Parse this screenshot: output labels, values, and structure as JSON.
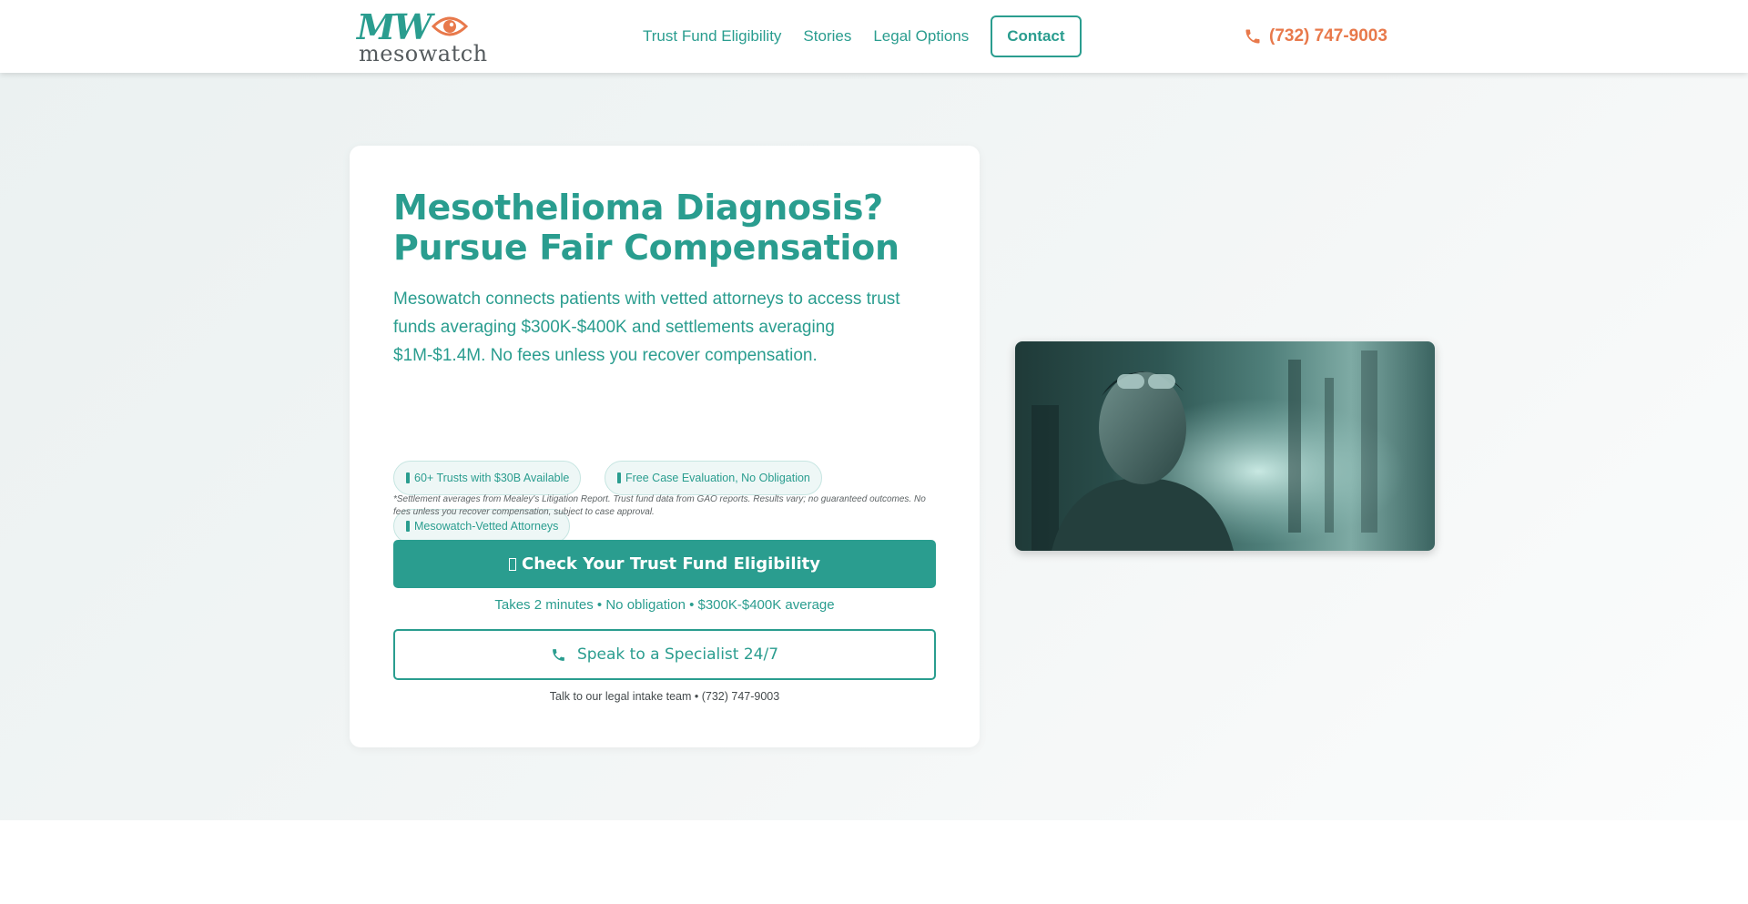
{
  "header": {
    "logo_mark": "MW",
    "logo_word": "mesowatch",
    "nav": [
      {
        "label": "Trust Fund Eligibility"
      },
      {
        "label": "Stories"
      },
      {
        "label": "Legal Options"
      }
    ],
    "contact_label": "Contact",
    "phone": "(732) 747-9003",
    "phone_icon": "phone-icon"
  },
  "hero": {
    "title_line1": "Mesothelioma Diagnosis?",
    "title_line2": "Pursue Fair Compensation",
    "subtitle": "Mesowatch connects patients with vetted attorneys to access trust funds averaging $300K-$400K and settlements averaging $1M-$1.4M. No fees unless you recover compensation.",
    "badges": [
      "60+ Trusts with $30B Available",
      "Free Case Evaluation, No Obligation",
      "Mesowatch-Vetted Attorneys"
    ],
    "disclaimer": "*Settlement averages from Mealey's Litigation Report. Trust fund data from GAO reports. Results vary; no guaranteed outcomes. No fees unless you recover compensation, subject to case approval.",
    "primary_cta": "Check Your Trust Fund Eligibility",
    "primary_note": "Takes 2 minutes • No obligation • $300K-$400K average",
    "secondary_cta": "Speak to a Specialist 24/7",
    "secondary_note": "Talk to our legal intake team • (732) 747-9003"
  },
  "colors": {
    "brand_teal": "#2a9d8f",
    "accent_orange": "#e8794b"
  }
}
